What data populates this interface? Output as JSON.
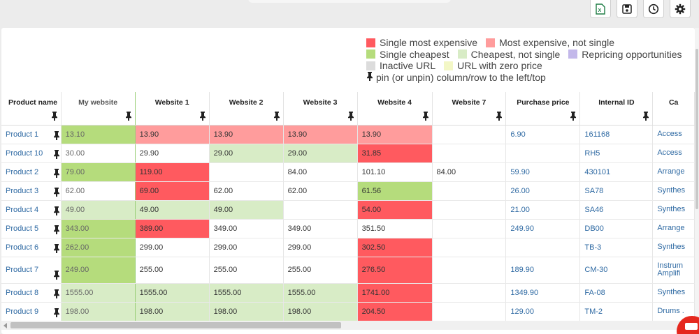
{
  "toolbar": {
    "buttons": [
      {
        "icon": "excel-export-icon",
        "color": "#1e7d45"
      },
      {
        "icon": "save-icon",
        "color": "#222222"
      },
      {
        "icon": "history-clock-icon",
        "color": "#222222"
      },
      {
        "icon": "settings-gear-icon",
        "color": "#222222"
      }
    ]
  },
  "legend": {
    "single_most_expensive": {
      "label": "Single most expensive",
      "color": "#ff5a5f"
    },
    "most_expensive_not_single": {
      "label": "Most expensive, not single",
      "color": "#ff9c9c"
    },
    "single_cheapest": {
      "label": "Single cheapest",
      "color": "#b5dc7c"
    },
    "cheapest_not_single": {
      "label": "Cheapest, not single",
      "color": "#d8ecc6"
    },
    "repricing": {
      "label": "Repricing opportunities",
      "color": "#c3b8ea"
    },
    "inactive_url": {
      "label": "Inactive URL",
      "color": "#dcdcdc"
    },
    "zero_price": {
      "label": "URL with zero price",
      "color": "#f3f7c6"
    },
    "pin_note": "pin (or unpin) column/row to the left/top"
  },
  "table": {
    "headers": [
      "Product name",
      "My website",
      "Website 1",
      "Website 2",
      "Website 3",
      "Website 4",
      "Website 7",
      "Purchase price",
      "Internal ID",
      "Ca"
    ],
    "rows": [
      {
        "name": "Product 1",
        "my": "13.10",
        "w1": "13.90",
        "w2": "13.90",
        "w3": "13.90",
        "w4": "13.90",
        "w7": "",
        "purchase": "6.90",
        "id": "161168",
        "cat": "Access"
      },
      {
        "name": "Product 10",
        "my": "30.00",
        "w1": "29.90",
        "w2": "29.00",
        "w3": "29.00",
        "w4": "31.85",
        "w7": "",
        "purchase": "",
        "id": "RH5",
        "cat": "Access"
      },
      {
        "name": "Product 2",
        "my": "79.00",
        "w1": "119.00",
        "w2": "",
        "w3": "84.00",
        "w4": "101.10",
        "w7": "84.00",
        "purchase": "59.90",
        "id": "430101",
        "cat": "Arrange"
      },
      {
        "name": "Product 3",
        "my": "62.00",
        "w1": "69.00",
        "w2": "62.00",
        "w3": "62.00",
        "w4": "61.56",
        "w7": "",
        "purchase": "26.00",
        "id": "SA78",
        "cat": "Synthes"
      },
      {
        "name": "Product 4",
        "my": "49.00",
        "w1": "49.00",
        "w2": "49.00",
        "w3": "",
        "w4": "54.00",
        "w7": "",
        "purchase": "21.00",
        "id": "SA46",
        "cat": "Synthes"
      },
      {
        "name": "Product 5",
        "my": "343.00",
        "w1": "389.00",
        "w2": "349.00",
        "w3": "349.00",
        "w4": "351.50",
        "w7": "",
        "purchase": "249.90",
        "id": "DB00",
        "cat": "Arrange"
      },
      {
        "name": "Product 6",
        "my": "262.00",
        "w1": "299.00",
        "w2": "299.00",
        "w3": "299.00",
        "w4": "302.50",
        "w7": "",
        "purchase": "",
        "id": "TB-3",
        "cat": "Synthes"
      },
      {
        "name": "Product 7",
        "my": "249.00",
        "w1": "255.00",
        "w2": "255.00",
        "w3": "255.00",
        "w4": "276.50",
        "w7": "",
        "purchase": "189.90",
        "id": "CM-30",
        "cat": "Instrum",
        "cat2": "Amplifi"
      },
      {
        "name": "Product 8",
        "my": "1555.00",
        "w1": "1555.00",
        "w2": "1555.00",
        "w3": "1555.00",
        "w4": "1741.00",
        "w7": "",
        "purchase": "1349.90",
        "id": "FA-08",
        "cat": "Synthes"
      },
      {
        "name": "Product 9",
        "my": "198.00",
        "w1": "198.00",
        "w2": "198.00",
        "w3": "198.00",
        "w4": "204.50",
        "w7": "",
        "purchase": "129.00",
        "id": "TM-2",
        "cat": "Drums ."
      }
    ]
  }
}
